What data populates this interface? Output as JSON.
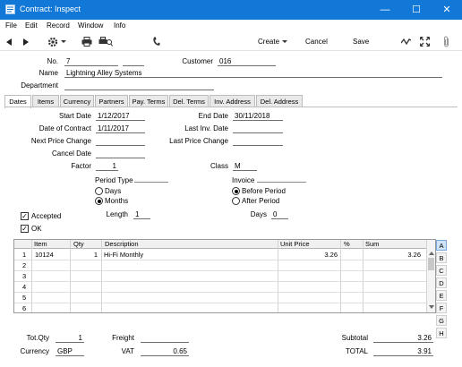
{
  "window": {
    "title": "Contract: Inspect",
    "minimize": "—",
    "maximize": "☐",
    "close": "✕"
  },
  "menu": [
    "File",
    "Edit",
    "Record",
    "Window",
    "Info"
  ],
  "toolbar": {
    "create": "Create",
    "cancel": "Cancel",
    "save": "Save"
  },
  "header": {
    "no_label": "No.",
    "no_value": "7",
    "customer_label": "Customer",
    "customer_value": "016",
    "name_label": "Name",
    "name_value": "Lightning Alley Systems",
    "department_label": "Department",
    "department_value": ""
  },
  "tabs": [
    "Dates",
    "Items",
    "Currency",
    "Partners",
    "Pay. Terms",
    "Del. Terms",
    "Inv. Address",
    "Del. Address"
  ],
  "dates": {
    "start_date_label": "Start Date",
    "start_date": "1/12/2017",
    "end_date_label": "End Date",
    "end_date": "30/11/2018",
    "date_of_contract_label": "Date of Contract",
    "date_of_contract": "1/11/2017",
    "last_inv_date_label": "Last Inv. Date",
    "last_inv_date": "",
    "next_price_change_label": "Next Price Change",
    "next_price_change": "",
    "last_price_change_label": "Last Price Change",
    "last_price_change": "",
    "cancel_date_label": "Cancel Date",
    "cancel_date": "",
    "factor_label": "Factor",
    "factor": "1",
    "class_label": "Class",
    "class": "M",
    "period_type_label": "Period Type",
    "period_days": "Days",
    "period_months": "Months",
    "invoice_label": "Invoice",
    "before_period": "Before Period",
    "after_period": "After Period",
    "length_label": "Length",
    "length": "1",
    "days_label": "Days",
    "days": "0",
    "accepted_label": "Accepted",
    "ok_label": "OK"
  },
  "grid": {
    "headers": {
      "item": "Item",
      "qty": "Qty",
      "description": "Description",
      "unit_price": "Unit Price",
      "pct": "%",
      "sum": "Sum"
    },
    "rows": [
      {
        "n": "1",
        "item": "10124",
        "qty": "1",
        "description": "Hi-Fi Monthly",
        "unit_price": "3.26",
        "pct": "",
        "sum": "3.26"
      },
      {
        "n": "2",
        "item": "",
        "qty": "",
        "description": "",
        "unit_price": "",
        "pct": "",
        "sum": ""
      },
      {
        "n": "3",
        "item": "",
        "qty": "",
        "description": "",
        "unit_price": "",
        "pct": "",
        "sum": ""
      },
      {
        "n": "4",
        "item": "",
        "qty": "",
        "description": "",
        "unit_price": "",
        "pct": "",
        "sum": ""
      },
      {
        "n": "5",
        "item": "",
        "qty": "",
        "description": "",
        "unit_price": "",
        "pct": "",
        "sum": ""
      },
      {
        "n": "6",
        "item": "",
        "qty": "",
        "description": "",
        "unit_price": "",
        "pct": "",
        "sum": ""
      }
    ],
    "side_tabs": [
      "A",
      "B",
      "C",
      "D",
      "E",
      "F",
      "G",
      "H"
    ]
  },
  "footer": {
    "tot_qty_label": "Tot.Qty",
    "tot_qty": "1",
    "freight_label": "Freight",
    "freight": "",
    "subtotal_label": "Subtotal",
    "subtotal": "3.26",
    "currency_label": "Currency",
    "currency": "GBP",
    "vat_label": "VAT",
    "vat": "0.65",
    "total_label": "TOTAL",
    "total": "3.91"
  }
}
